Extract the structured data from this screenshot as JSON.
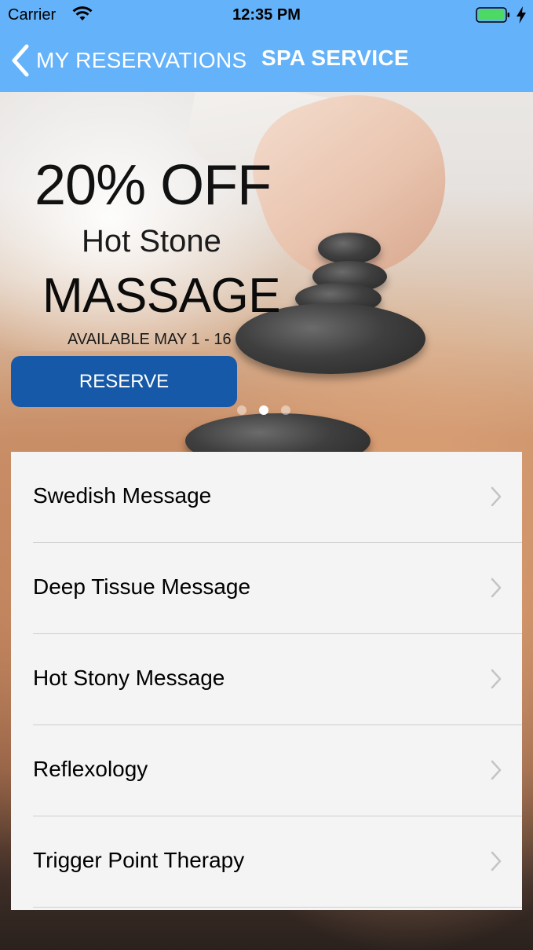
{
  "status_bar": {
    "carrier": "Carrier",
    "time": "12:35 PM",
    "battery_color": "#4cd964",
    "icons": [
      "wifi-icon",
      "battery-icon",
      "charging-icon"
    ]
  },
  "nav": {
    "back_label": "MY RESERVATIONS",
    "title": "SPA SERVICE",
    "bar_color": "#64b2f9"
  },
  "promo": {
    "discount": "20% OFF",
    "subtitle": "Hot Stone",
    "title": "MASSAGE",
    "dates": "AVAILABLE MAY 1 - 16",
    "reserve_label": "RESERVE",
    "reserve_color": "#1559a8",
    "page_count": 3,
    "current_page": 2
  },
  "services": [
    {
      "label": "Swedish Message"
    },
    {
      "label": "Deep Tissue Message"
    },
    {
      "label": "Hot Stony Message"
    },
    {
      "label": "Reflexology"
    },
    {
      "label": "Trigger Point Therapy"
    }
  ]
}
